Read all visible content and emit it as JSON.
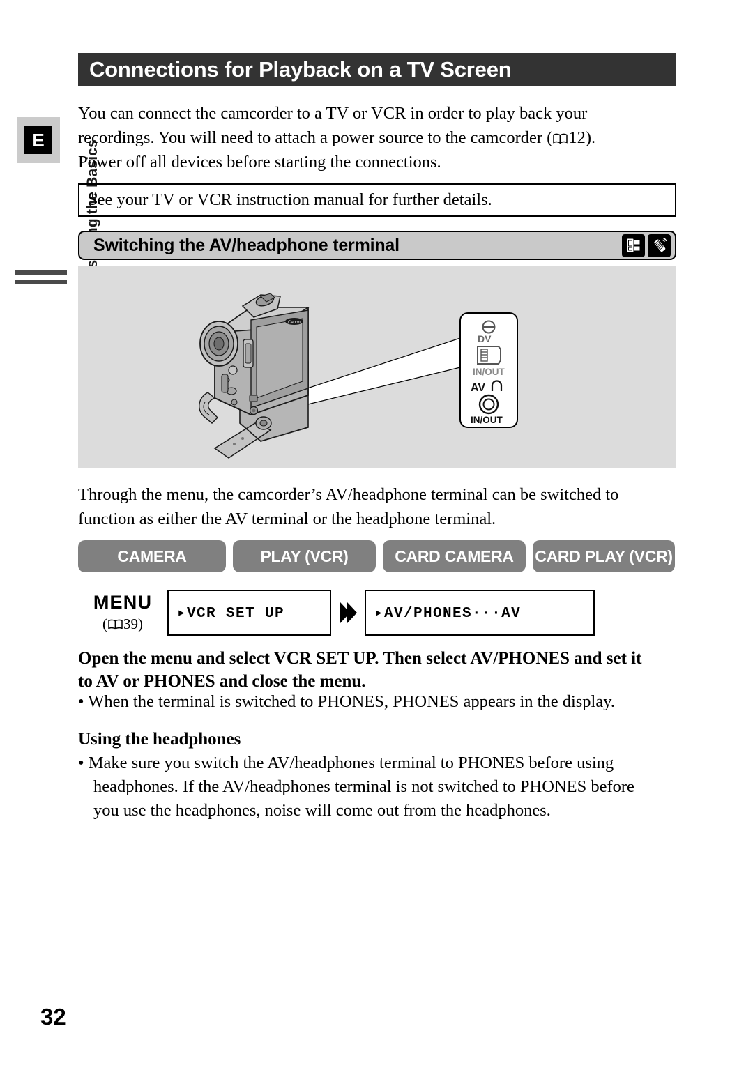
{
  "page": {
    "number": "32",
    "language_tab": "E",
    "side_tab_line1": "Mastering",
    "side_tab_line2": "the Basics"
  },
  "title": {
    "text": "Connections for Playback on a TV Screen"
  },
  "intro": {
    "line1": "You can connect the camcorder to a TV or VCR in order to play back your",
    "line2_a": "recordings. You will need to attach a power source to the camcorder (",
    "line2_ref": "12).",
    "line3": "Power off all devices before starting the connections."
  },
  "note_box": {
    "text": "See your TV or VCR instruction manual for further details."
  },
  "section": {
    "heading": "Switching the AV/headphone terminal",
    "icons": [
      "memory-card-camcorder-icon",
      "remote-control-icon"
    ]
  },
  "diagram": {
    "terminal_labels": {
      "dv": "DV",
      "dv_inout": "IN/OUT",
      "av": "AV",
      "av_inout": "IN/OUT"
    },
    "brand": "Canon"
  },
  "mid_paragraph": {
    "line1": "Through the menu, the camcorder’s AV/headphone terminal can be switched to",
    "line2": "function as either the AV terminal or the headphone terminal."
  },
  "modes": [
    {
      "label": "CAMERA"
    },
    {
      "label": "PLAY (VCR)"
    },
    {
      "label": "CARD CAMERA"
    },
    {
      "label": "CARD PLAY (VCR)"
    }
  ],
  "menu": {
    "label": "MENU",
    "ref_open": "(",
    "ref_page": "39)",
    "box1": "▸VCR SET UP",
    "box2": "▸AV/PHONES···AV"
  },
  "instructions": {
    "bold_line1": "Open the menu and select VCR SET UP. Then select AV/PHONES and set it",
    "bold_line2": "to AV or PHONES and close the menu.",
    "bullet1": "• When the terminal is switched to PHONES, PHONES appears in the display."
  },
  "headphones": {
    "heading": "Using the headphones",
    "bullet_line1": "• Make sure you switch the AV/headphones terminal to PHONES before using",
    "bullet_line2": "headphones. If the AV/headphones terminal is not switched to PHONES before",
    "bullet_line3": "you use the headphones, noise will come out from the headphones."
  },
  "colors": {
    "title_bar": "#333333",
    "section_head": "#c9c9c9",
    "diagram_bg": "#dcdcdc",
    "mode_button": "#808080",
    "side_tab_grey": "#d9d9d9"
  }
}
